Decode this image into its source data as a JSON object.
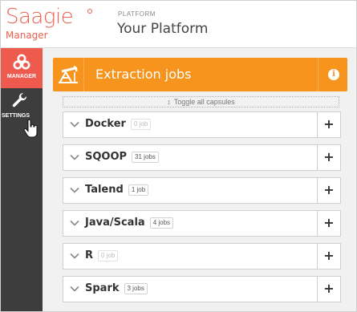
{
  "header": {
    "logo": "Saagie",
    "logo_sub": "Manager",
    "platform_label": "PLATFORM",
    "platform_name": "Your Platform"
  },
  "sidebar": {
    "items": [
      {
        "label": "MANAGER",
        "icon": "biohazard-icon",
        "active": true
      },
      {
        "label": "SETTINGS",
        "icon": "wrench-icon",
        "active": false
      }
    ]
  },
  "panel": {
    "title": "Extraction jobs",
    "icon": "oil-pump-icon",
    "info_icon": "info-icon",
    "toggle_label": "Toggle all capsules",
    "accent": "#f7941d"
  },
  "jobs": [
    {
      "name": "Docker",
      "count": "0 job",
      "empty": true
    },
    {
      "name": "SQOOP",
      "count": "31 jobs",
      "empty": false
    },
    {
      "name": "Talend",
      "count": "1 job",
      "empty": false
    },
    {
      "name": "Java/Scala",
      "count": "4 jobs",
      "empty": false
    },
    {
      "name": "R",
      "count": "0 job",
      "empty": true
    },
    {
      "name": "Spark",
      "count": "3 jobs",
      "empty": false
    }
  ],
  "add_label": "+",
  "colors": {
    "brand": "#e9604f",
    "sidebar": "#3d3d3d",
    "active_nav": "#ef5a4f"
  }
}
